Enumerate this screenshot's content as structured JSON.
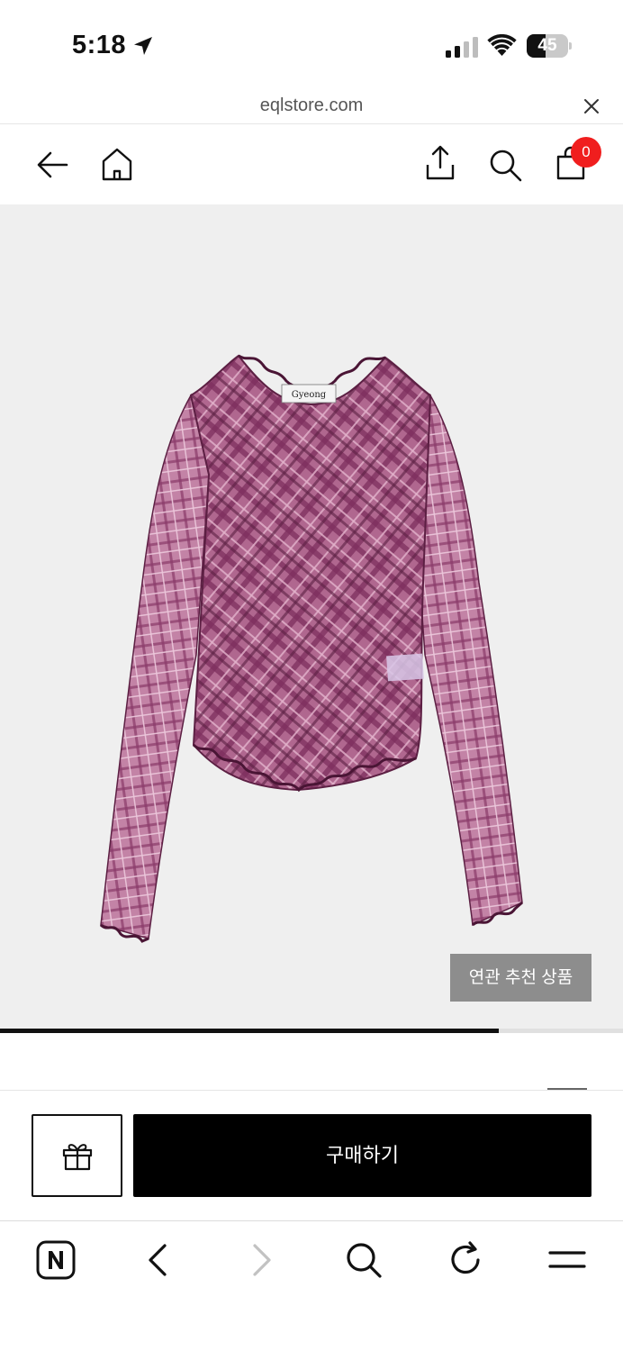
{
  "status_bar": {
    "time": "5:18",
    "battery_level": "45",
    "battery_fraction": 0.45,
    "icons": [
      "location-arrow-icon",
      "cellular-signal-icon",
      "wifi-icon",
      "battery-icon"
    ]
  },
  "url_bar": {
    "domain": "eqlstore.com",
    "close_icon": "close-icon"
  },
  "header": {
    "icons": [
      "back-arrow-icon",
      "home-icon",
      "share-icon",
      "search-icon",
      "shopping-bag-icon"
    ],
    "cart_count": "0"
  },
  "product": {
    "image_subject": "plaid-mesh-long-sleeve-top",
    "label_text": "Gyeong",
    "related_button_label": "연관 추천 상품",
    "carousel_progress": 0.8
  },
  "purchase_bar": {
    "gift_icon": "gift-icon",
    "buy_label": "구매하기"
  },
  "browser_toolbar": {
    "icons": [
      "naver-home-icon",
      "browser-back-icon",
      "browser-forward-icon",
      "browser-search-icon",
      "refresh-icon",
      "menu-icon"
    ]
  },
  "colors": {
    "accent_black": "#000000",
    "badge_red": "#f01e1e",
    "image_background": "#efefef",
    "garment_purple": "#9a4a7c"
  }
}
